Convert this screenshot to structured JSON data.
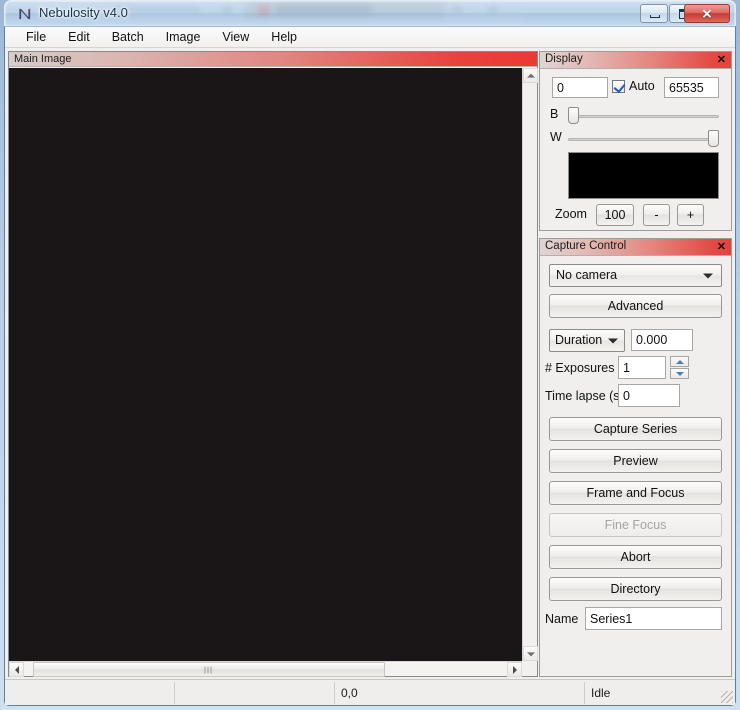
{
  "window": {
    "title": "Nebulosity v4.0",
    "icon": "app-n-icon",
    "controls": {
      "minimize": "minimize-icon",
      "maximize": "maximize-icon",
      "close": "✕"
    }
  },
  "menu": {
    "items": [
      {
        "label": "File"
      },
      {
        "label": "Edit"
      },
      {
        "label": "Batch"
      },
      {
        "label": "Image"
      },
      {
        "label": "View"
      },
      {
        "label": "Help"
      }
    ]
  },
  "image_pane": {
    "caption": "Main Image",
    "canvas_color": "#1a1617"
  },
  "display_panel": {
    "title": "Display",
    "close_label": "✕",
    "black_value": "0",
    "auto_label": "Auto",
    "auto_checked": true,
    "white_value": "65535",
    "black_slider_label": "B",
    "white_slider_label": "W",
    "zoom_label": "Zoom",
    "zoom_value": "100",
    "zoom_minus": "-",
    "zoom_plus": "+"
  },
  "capture_panel": {
    "title": "Capture Control",
    "close_label": "✕",
    "camera_value": "No camera",
    "advanced_label": "Advanced",
    "duration_mode": "Duration",
    "duration_value": "0.000",
    "exposures_label": "# Exposures",
    "exposures_value": "1",
    "timelapse_label": "Time lapse (s)",
    "timelapse_value": "0",
    "capture_series_label": "Capture Series",
    "preview_label": "Preview",
    "frame_focus_label": "Frame and Focus",
    "fine_focus_label": "Fine Focus",
    "abort_label": "Abort",
    "directory_label": "Directory",
    "name_label": "Name",
    "name_value": "Series1"
  },
  "status_bar": {
    "pane0": "",
    "pane1": "",
    "coordinates": "0,0",
    "state": "Idle"
  },
  "colors": {
    "panel_header_accent": "#e5433d",
    "title_bar": "#c8ddf1",
    "canvas": "#1a1617",
    "checkbox_check": "#2b5ca8"
  }
}
